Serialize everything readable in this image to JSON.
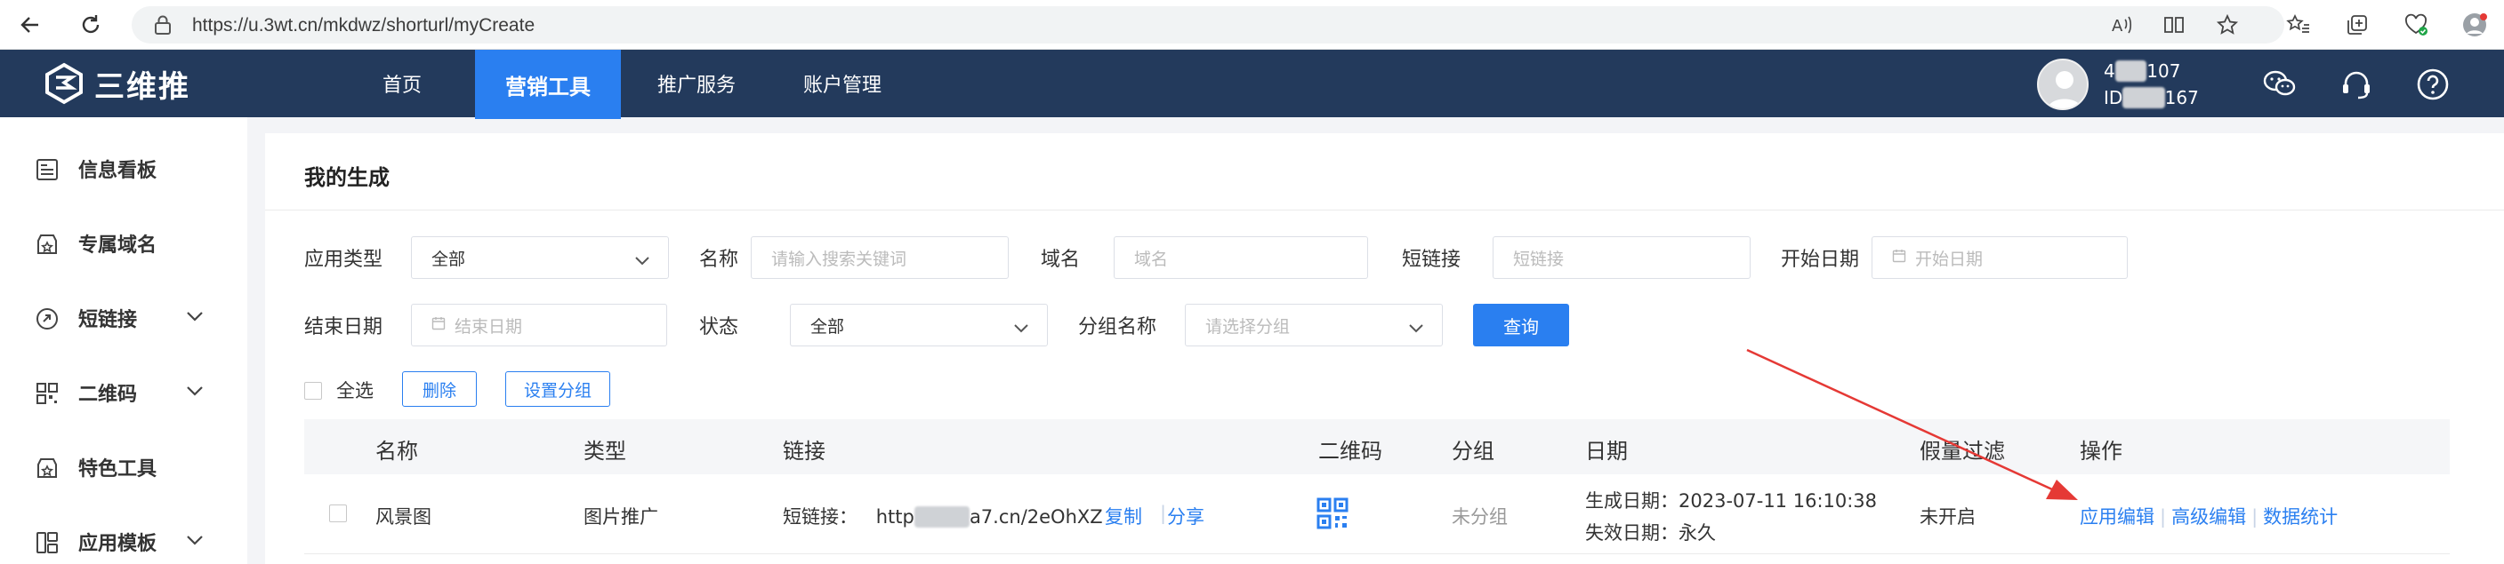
{
  "browser": {
    "url": "https://u.3wt.cn/mkdwz/shorturl/myCreate"
  },
  "brand": {
    "name": "三维推"
  },
  "topnav": {
    "items": [
      {
        "label": "首页"
      },
      {
        "label": "营销工具"
      },
      {
        "label": "推广服务"
      },
      {
        "label": "账户管理"
      }
    ],
    "active": "营销工具"
  },
  "user": {
    "name_visible": "4",
    "name_tail": "107",
    "id_prefix": "ID",
    "id_tail": "167"
  },
  "sidebar": {
    "items": [
      {
        "label": "信息看板"
      },
      {
        "label": "专属域名"
      },
      {
        "label": "短链接"
      },
      {
        "label": "二维码"
      },
      {
        "label": "特色工具"
      },
      {
        "label": "应用模板"
      }
    ]
  },
  "page": {
    "title": "我的生成"
  },
  "filters": {
    "app_type_label": "应用类型",
    "app_type_value": "全部",
    "name_label": "名称",
    "name_placeholder": "请输入搜索关键词",
    "domain_label": "域名",
    "domain_placeholder": "域名",
    "shortlink_label": "短链接",
    "shortlink_placeholder": "短链接",
    "start_date_label": "开始日期",
    "start_date_placeholder": "开始日期",
    "end_date_label": "结束日期",
    "end_date_placeholder": "结束日期",
    "status_label": "状态",
    "status_value": "全部",
    "group_label": "分组名称",
    "group_placeholder": "请选择分组",
    "query_label": "查询"
  },
  "bulk": {
    "select_all": "全选",
    "delete": "删除",
    "set_group": "设置分组"
  },
  "table": {
    "columns": [
      "名称",
      "类型",
      "链接",
      "二维码",
      "分组",
      "日期",
      "假量过滤",
      "操作"
    ],
    "rows": [
      {
        "name": "风景图",
        "type": "图片推广",
        "link_prefix": "短链接：",
        "link_head": "http",
        "link_tail": "a7.cn/2eOhXZ",
        "copy": "复制",
        "share": "分享",
        "group": "未分组",
        "created": "生成日期：2023-07-11 16:10:38",
        "expires": "失效日期：永久",
        "fake_filter": "未开启",
        "actions": [
          "应用编辑",
          "高级编辑",
          "数据统计"
        ]
      }
    ]
  },
  "colors": {
    "navbar": "#233a5c",
    "accent": "#2a7ff0",
    "arrow": "#e53935"
  }
}
